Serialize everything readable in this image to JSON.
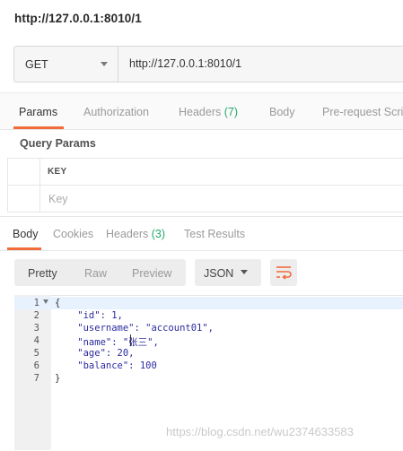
{
  "request": {
    "title": "http://127.0.0.1:8010/1",
    "method": "GET",
    "url": "http://127.0.0.1:8010/1"
  },
  "request_tabs": [
    {
      "label": "Params",
      "active": true
    },
    {
      "label": "Authorization"
    },
    {
      "label": "Headers ",
      "count": "(7)"
    },
    {
      "label": "Body"
    },
    {
      "label": "Pre-request Scrip"
    }
  ],
  "query_params": {
    "title": "Query Params",
    "key_header": "KEY",
    "key_placeholder": "Key"
  },
  "response_tabs": [
    {
      "label": "Body",
      "active": true
    },
    {
      "label": "Cookies"
    },
    {
      "label": "Headers ",
      "count": "(3)"
    },
    {
      "label": "Test Results"
    }
  ],
  "view_modes": [
    "Pretty",
    "Raw",
    "Preview"
  ],
  "active_view": "Pretty",
  "format": "JSON",
  "wrap_icon": "wrap-lines-icon",
  "accent_color": "#f26b3a",
  "count_color": "#26a96c",
  "code": {
    "line_numbers": [
      "1",
      "2",
      "3",
      "4",
      "5",
      "6",
      "7"
    ],
    "lines": [
      "{",
      "    \"id\": 1,",
      "    \"username\": \"account01\",",
      "    \"name\": \"张三\",",
      "    \"age\": 20,",
      "    \"balance\": 100",
      "}"
    ]
  },
  "watermark": "https://blog.csdn.net/wu2374633583"
}
